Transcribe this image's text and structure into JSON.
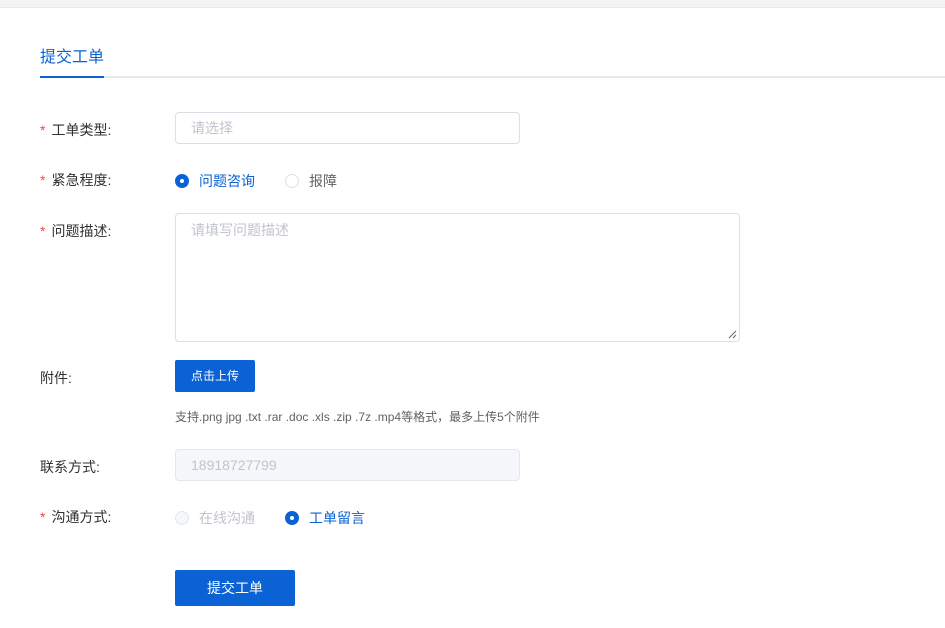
{
  "tabs": {
    "active_label": "提交工单"
  },
  "form": {
    "ticket_type": {
      "label": "工单类型:",
      "required": "*",
      "placeholder": "请选择"
    },
    "urgency": {
      "label": "紧急程度:",
      "required": "*",
      "options": [
        "问题咨询",
        "报障"
      ],
      "selected": "问题咨询"
    },
    "description": {
      "label": "问题描述:",
      "required": "*",
      "placeholder": "请填写问题描述"
    },
    "attachment": {
      "label": "附件:",
      "button_label": "点击上传",
      "hint": "支持.png jpg .txt .rar .doc .xls .zip .7z .mp4等格式，最多上传5个附件"
    },
    "contact": {
      "label": "联系方式:",
      "value": "18918727799"
    },
    "channel": {
      "label": "沟通方式:",
      "required": "*",
      "options": [
        "在线沟通",
        "工单留言"
      ],
      "selected": "工单留言",
      "disabled": [
        "在线沟通"
      ]
    },
    "submit_label": "提交工单"
  },
  "colors": {
    "accent": "#0b62d4",
    "required": "#f04a3e",
    "page_bg": "#f2f3f5"
  },
  "icons": {
    "resize": "resize-handle-icon"
  }
}
